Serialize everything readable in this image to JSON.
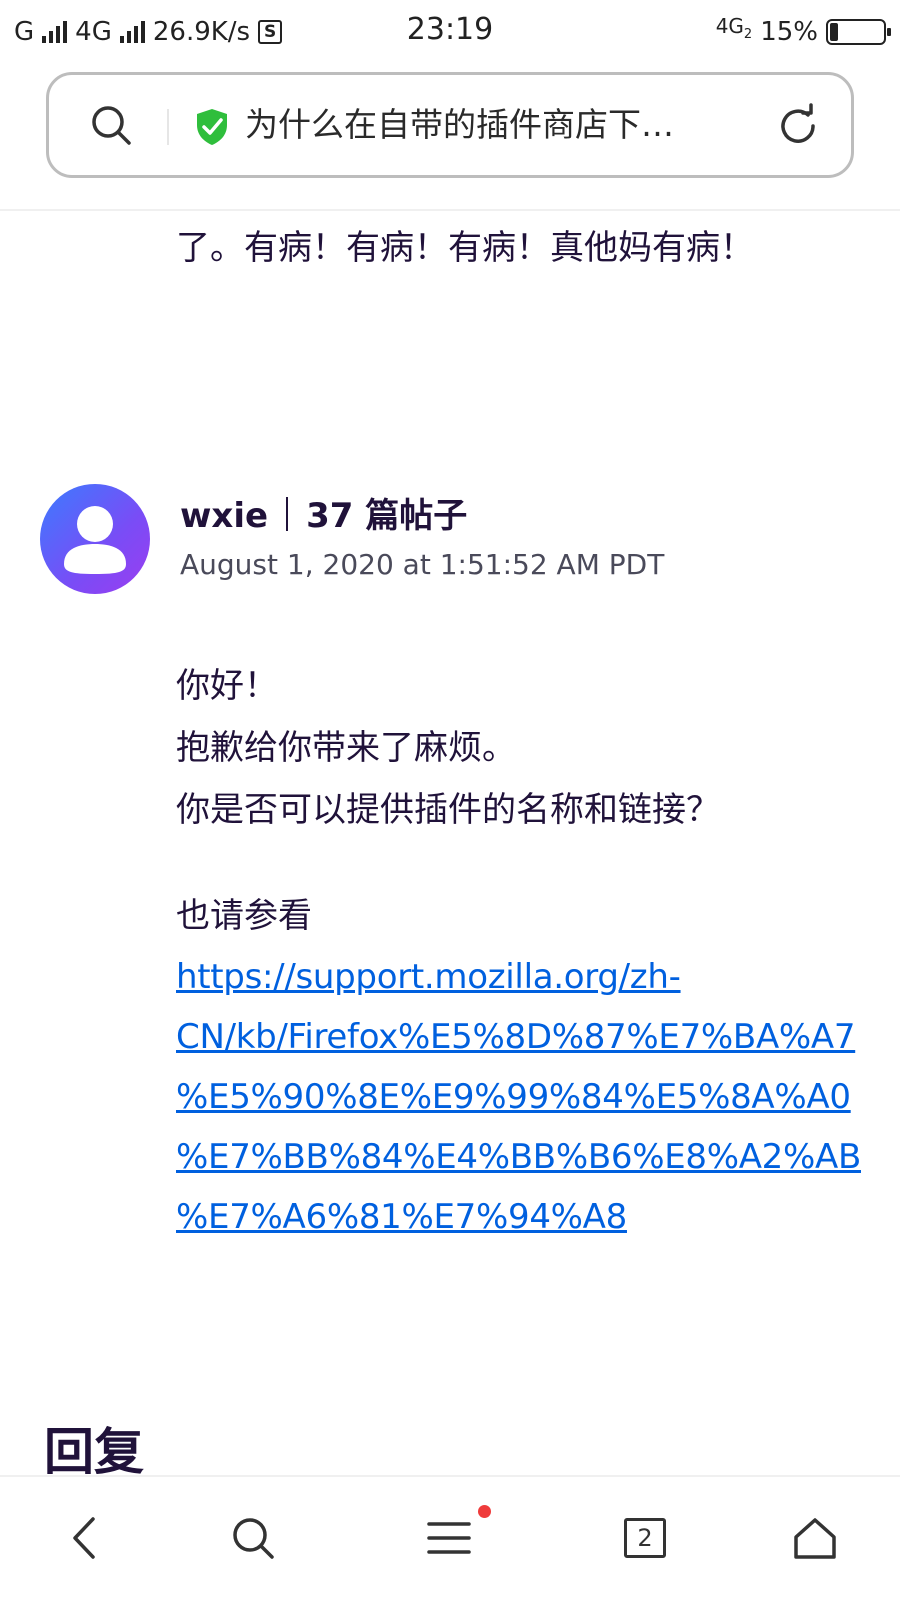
{
  "status_bar": {
    "carrier1": "G",
    "carrier2": "4G",
    "speed": "26.9K/s",
    "sim_icon": "S",
    "time": "23:19",
    "network": "4G",
    "network_sub": "2",
    "battery": "15%",
    "battery_level": 0.15
  },
  "url_bar": {
    "title": "为什么在自带的插件商店下…",
    "search_icon": "search-icon",
    "secure_icon": "shield-check-icon",
    "reload_icon": "reload-icon"
  },
  "previous_post": {
    "text": "了。有病！有病！有病！真他妈有病！"
  },
  "post": {
    "author": "wxie",
    "post_count": "37 篇帖子",
    "date": "August 1, 2020 at 1:51:52 AM PDT",
    "lines": [
      "你好！",
      "抱歉给你带来了麻烦。",
      "你是否可以提供插件的名称和链接？"
    ],
    "see_also": "也请参看",
    "link_lines": [
      "https://support.mozilla.org/zh-",
      "CN/kb/Firefox%E5%8D%87%E7%BA%A7",
      "%E5%90%8E%E9%99%84%E5%8A%A0",
      "%E7%BB%84%E4%BB%B6%E8%A2%AB",
      "%E7%A6%81%E7%94%A8"
    ]
  },
  "reply_heading": "回复",
  "bottom_nav": {
    "tab_count": "2",
    "back_icon": "back-icon",
    "search_icon": "search-icon",
    "menu_icon": "menu-icon",
    "tabs_icon": "tabs-icon",
    "home_icon": "home-icon",
    "notification_color": "#ef3b3b"
  },
  "colors": {
    "link": "#0060df",
    "text": "#20123a",
    "secure_shield": "#2fbe3c"
  }
}
